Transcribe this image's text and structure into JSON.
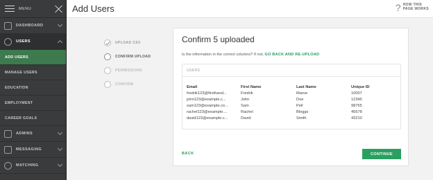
{
  "sidebar": {
    "menu_label": "MENU",
    "items": [
      {
        "label": "DASHBOARD",
        "icon": "home-icon"
      },
      {
        "label": "USERS",
        "icon": "user-icon"
      },
      {
        "label": "ADMINS",
        "icon": "shield-icon"
      },
      {
        "label": "MESSAGING",
        "icon": "message-icon"
      },
      {
        "label": "MATCHING",
        "icon": "match-icon"
      }
    ],
    "users_sub": [
      "ADD USERS",
      "MANAGE USERS",
      "EDUCATION",
      "EMPLOYMENT",
      "CAREER GOALS"
    ]
  },
  "header": {
    "title": "Add Users",
    "help_line1": "HOW THIS",
    "help_line2": "PAGE WORKS"
  },
  "steps": [
    {
      "label": "UPLOAD CSV",
      "state": "done"
    },
    {
      "label": "CONFIRM UPLOAD",
      "state": "current"
    },
    {
      "label": "PERMISSIONS",
      "state": "future"
    },
    {
      "label": "CONFIRM",
      "state": "future"
    }
  ],
  "card": {
    "title": "Confirm 5 uploaded",
    "question": "Is the information in the correct columns? If not,",
    "reupload_link": "GO BACK AND RE-UPLOAD",
    "users_header": "USERS",
    "columns": [
      "Email",
      "First Name",
      "Last Name",
      "Unique ID"
    ],
    "rows": [
      [
        "fredrik123@firsthand...",
        "Fredrik",
        "Maroe",
        "10007"
      ],
      [
        "john123@example.c...",
        "John",
        "Doe",
        "12345"
      ],
      [
        "sam123@example.co...",
        "Sam",
        "Pell",
        "98765"
      ],
      [
        "rachel123@example....",
        "Rachel",
        "Bloggs",
        "45678"
      ],
      [
        "david123@example.c...",
        "David",
        "Smith",
        "43210"
      ]
    ],
    "back_label": "BACK",
    "continue_label": "CONTINUE"
  },
  "colors": {
    "accent": "#2aa060",
    "sidebar_bg": "#3a3b3c",
    "active_item": "#3d7a4d"
  }
}
